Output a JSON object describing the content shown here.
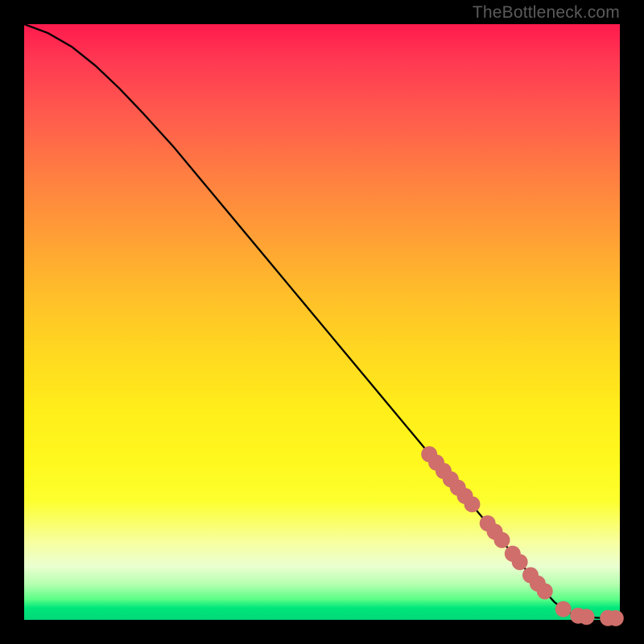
{
  "attribution": "TheBottleneck.com",
  "colors": {
    "frame": "#000000",
    "curve": "#000000",
    "marker": "#cf6e6a",
    "gradient_top": "#ff1a4d",
    "gradient_bottom": "#00d878"
  },
  "chart_data": {
    "type": "line",
    "title": "",
    "xlabel": "",
    "ylabel": "",
    "xlim": [
      0,
      100
    ],
    "ylim": [
      0,
      100
    ],
    "grid": false,
    "legend": false,
    "curve": {
      "name": "bottleneck-curve",
      "x": [
        0,
        4,
        8,
        12,
        16,
        20,
        25,
        30,
        35,
        40,
        45,
        50,
        55,
        60,
        65,
        70,
        75,
        80,
        84,
        87,
        89,
        90.5,
        92,
        94,
        96,
        98,
        100
      ],
      "y": [
        100,
        98.5,
        96.2,
        93.0,
        89.2,
        85.0,
        79.5,
        73.5,
        67.5,
        61.5,
        55.5,
        49.5,
        43.5,
        37.5,
        31.5,
        25.5,
        19.5,
        13.5,
        8.7,
        5.2,
        3.0,
        1.8,
        1.0,
        0.55,
        0.35,
        0.28,
        0.25
      ]
    },
    "markers": {
      "name": "highlighted-points",
      "points": [
        {
          "x": 68.0,
          "y": 27.8
        },
        {
          "x": 69.2,
          "y": 26.4
        },
        {
          "x": 70.4,
          "y": 25.0
        },
        {
          "x": 71.6,
          "y": 23.6
        },
        {
          "x": 72.8,
          "y": 22.2
        },
        {
          "x": 74.0,
          "y": 20.8
        },
        {
          "x": 75.2,
          "y": 19.4
        },
        {
          "x": 77.8,
          "y": 16.2
        },
        {
          "x": 79.0,
          "y": 14.8
        },
        {
          "x": 80.2,
          "y": 13.4
        },
        {
          "x": 82.0,
          "y": 11.1
        },
        {
          "x": 83.2,
          "y": 9.7
        },
        {
          "x": 85.0,
          "y": 7.5
        },
        {
          "x": 86.2,
          "y": 6.1
        },
        {
          "x": 87.4,
          "y": 4.8
        },
        {
          "x": 90.5,
          "y": 1.8
        },
        {
          "x": 93.0,
          "y": 0.7
        },
        {
          "x": 94.4,
          "y": 0.5
        },
        {
          "x": 98.0,
          "y": 0.3
        },
        {
          "x": 99.3,
          "y": 0.28
        }
      ],
      "radius_chart_units": 1.35
    }
  }
}
